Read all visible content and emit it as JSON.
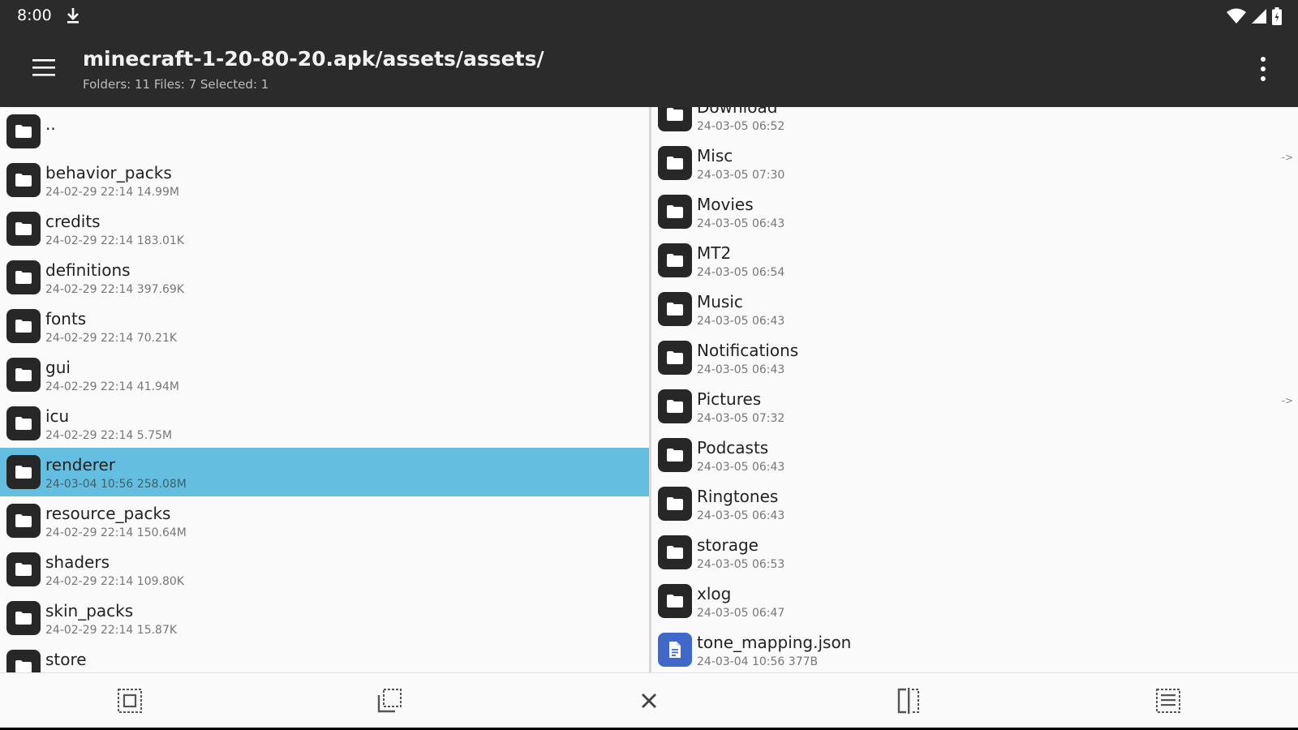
{
  "status": {
    "time": "8:00"
  },
  "appbar": {
    "title": "minecraft-1-20-80-20.apk/assets/assets/",
    "subtitle": "Folders: 11  Files: 7  Selected: 1"
  },
  "left_pane": {
    "items": [
      {
        "name": "..",
        "meta": "",
        "type": "folder",
        "selected": false
      },
      {
        "name": "behavior_packs",
        "meta": "24-02-29 22:14  14.99M",
        "type": "folder",
        "selected": false
      },
      {
        "name": "credits",
        "meta": "24-02-29 22:14  183.01K",
        "type": "folder",
        "selected": false
      },
      {
        "name": "definitions",
        "meta": "24-02-29 22:14  397.69K",
        "type": "folder",
        "selected": false
      },
      {
        "name": "fonts",
        "meta": "24-02-29 22:14  70.21K",
        "type": "folder",
        "selected": false
      },
      {
        "name": "gui",
        "meta": "24-02-29 22:14  41.94M",
        "type": "folder",
        "selected": false
      },
      {
        "name": "icu",
        "meta": "24-02-29 22:14  5.75M",
        "type": "folder",
        "selected": false
      },
      {
        "name": "renderer",
        "meta": "24-03-04 10:56  258.08M",
        "type": "folder",
        "selected": true
      },
      {
        "name": "resource_packs",
        "meta": "24-02-29 22:14  150.64M",
        "type": "folder",
        "selected": false
      },
      {
        "name": "shaders",
        "meta": "24-02-29 22:14  109.80K",
        "type": "folder",
        "selected": false
      },
      {
        "name": "skin_packs",
        "meta": "24-02-29 22:14  15.87K",
        "type": "folder",
        "selected": false
      },
      {
        "name": "store",
        "meta": "",
        "type": "folder",
        "selected": false
      }
    ]
  },
  "right_pane": {
    "items": [
      {
        "name": "Download",
        "meta": "24-03-05 06:52",
        "type": "folder",
        "arrow": ""
      },
      {
        "name": "Misc",
        "meta": "24-03-05 07:30",
        "type": "folder",
        "arrow": "->"
      },
      {
        "name": "Movies",
        "meta": "24-03-05 06:43",
        "type": "folder",
        "arrow": ""
      },
      {
        "name": "MT2",
        "meta": "24-03-05 06:54",
        "type": "folder",
        "arrow": ""
      },
      {
        "name": "Music",
        "meta": "24-03-05 06:43",
        "type": "folder",
        "arrow": ""
      },
      {
        "name": "Notifications",
        "meta": "24-03-05 06:43",
        "type": "folder",
        "arrow": ""
      },
      {
        "name": "Pictures",
        "meta": "24-03-05 07:32",
        "type": "folder",
        "arrow": "->"
      },
      {
        "name": "Podcasts",
        "meta": "24-03-05 06:43",
        "type": "folder",
        "arrow": ""
      },
      {
        "name": "Ringtones",
        "meta": "24-03-05 06:43",
        "type": "folder",
        "arrow": ""
      },
      {
        "name": "storage",
        "meta": "24-03-05 06:53",
        "type": "folder",
        "arrow": ""
      },
      {
        "name": "xlog",
        "meta": "24-03-05 06:47",
        "type": "folder",
        "arrow": ""
      },
      {
        "name": "tone_mapping.json",
        "meta": "24-03-04 10:56  377B",
        "type": "file",
        "arrow": ""
      }
    ]
  },
  "toolbar": {
    "buttons": [
      "select-all-icon",
      "copy-icon",
      "close-icon",
      "split-view-icon",
      "list-view-icon"
    ]
  },
  "colors": {
    "bar": "#2b2b2b",
    "selected": "#64bedf",
    "file_icon": "#3f68c8",
    "folder_icon": "#272727"
  }
}
